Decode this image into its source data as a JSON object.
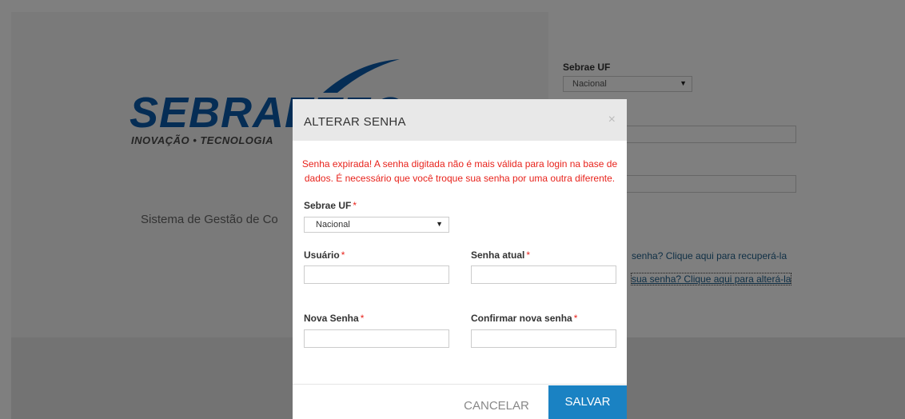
{
  "background": {
    "logo": {
      "word": "SEBRAETEC",
      "tagline": "INOVAÇÃO • TECNOLOGIA"
    },
    "system_title": "Sistema de Gestão de Co",
    "uf_label": "Sebrae UF",
    "uf_value": "Nacional",
    "link_recover": "senha? Clique aqui para recuperá-la",
    "link_change": "sua senha? Clique aqui para alterá-la"
  },
  "modal": {
    "title": "ALTERAR SENHA",
    "close_symbol": "×",
    "alert": "Senha expirada! A senha digitada não é mais válida para login na base de dados. É necessário que você troque sua senha por uma outra diferente.",
    "uf_label": "Sebrae UF",
    "uf_value": "Nacional",
    "user_label": "Usuário",
    "current_password_label": "Senha atual",
    "new_password_label": "Nova Senha",
    "confirm_password_label": "Confirmar nova senha",
    "required_marker": "*",
    "cancel_label": "CANCELAR",
    "save_label": "SALVAR"
  },
  "colors": {
    "accent": "#1a82c3",
    "alert": "#e8231c",
    "logo_blue": "#0b5bab"
  }
}
